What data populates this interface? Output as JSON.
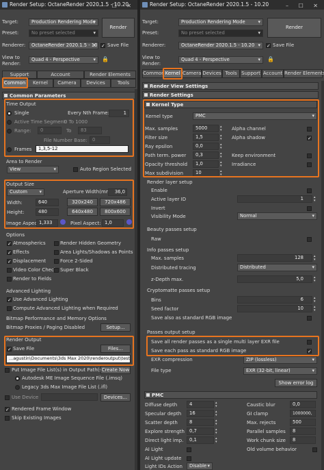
{
  "left_window": {
    "title": "Render Setup: OctaneRender 2020.1.5 - 10.20",
    "target_label": "Target:",
    "target_value": "Production Rendering Mode",
    "preset_label": "Preset:",
    "preset_value": "No preset selected",
    "renderer_label": "Renderer:",
    "renderer_value": "OctaneRender 2020.1.5 - 10.",
    "save_file_label": "Save File",
    "view_label": "View to Render:",
    "view_value": "Quad 4 - Perspective",
    "render_label": "Render",
    "tabs_row1": [
      "Support",
      "Account",
      "Render Elements"
    ],
    "tabs_row2": [
      "Common",
      "Kernel",
      "Camera",
      "Devices",
      "Tools"
    ],
    "rollout": "Common Parameters",
    "time_output": {
      "heading": "Time Output",
      "single": "Single",
      "every_nth": "Every Nth Frame:",
      "every_nth_value": "1",
      "active_segment": "Active Time Segment:",
      "active_segment_value": "0 To 1000",
      "range": "Range:",
      "range_from": "0",
      "to": "To",
      "range_to": "83",
      "file_number_base": "File Number Base:",
      "file_number_base_value": "0",
      "frames": "Frames",
      "frames_value": "1,3,5-12"
    },
    "area": {
      "heading": "Area to Render",
      "value": "View",
      "auto_region": "Auto Region Selected"
    },
    "output_size": {
      "heading": "Output Size",
      "preset": "Custom",
      "aperture_label": "Aperture Width(mm):",
      "aperture_value": "36,0",
      "width_label": "Width:",
      "width_value": "640",
      "height_label": "Height:",
      "height_value": "480",
      "presets": [
        "320x240",
        "720x486",
        "640x480",
        "800x600"
      ],
      "image_aspect_label": "Image Aspect:",
      "image_aspect_value": "1,333",
      "pixel_aspect_label": "Pixel Aspect:",
      "pixel_aspect_value": "1,0"
    },
    "options": {
      "heading": "Options",
      "items": [
        {
          "label": "Atmospherics",
          "checked": true
        },
        {
          "label": "Render Hidden Geometry",
          "checked": false
        },
        {
          "label": "Effects",
          "checked": true
        },
        {
          "label": "Area Lights/Shadows as Points",
          "checked": false
        },
        {
          "label": "Displacement",
          "checked": true
        },
        {
          "label": "Force 2-Sided",
          "checked": false
        },
        {
          "label": "Video Color Check",
          "checked": false
        },
        {
          "label": "Super Black",
          "checked": false
        },
        {
          "label": "Render to Fields",
          "checked": false
        }
      ]
    },
    "adv_lighting": {
      "heading": "Advanced Lighting",
      "use": "Use Advanced Lighting",
      "compute": "Compute Advanced Lighting when Required"
    },
    "bitmap": {
      "heading": "Bitmap Performance and Memory Options",
      "proxies": "Bitmap Proxies / Paging Disabled",
      "setup": "Setup..."
    },
    "render_output": {
      "heading": "Render Output",
      "save_file": "Save File",
      "files": "Files...",
      "path": "...agustin\\Documents\\3ds Max 2020\\renderoutput\\test.png",
      "put_image": "Put Image File List(s) in Output Path(s)",
      "create_now": "Create Now",
      "autodesk": "Autodesk ME Image Sequence File (.imsq)",
      "legacy": "Legacy 3ds Max Image File List (.ifl)",
      "use_device": "Use Device",
      "devices": "Devices...",
      "rendered_frame": "Rendered Frame Window",
      "skip": "Skip Existing Images"
    }
  },
  "right_window": {
    "title": "Render Setup: OctaneRender 2020.1.5 - 10.20",
    "target_label": "Target:",
    "target_value": "Production Rendering Mode",
    "preset_label": "Preset:",
    "preset_value": "No preset selected",
    "renderer_label": "Renderer:",
    "renderer_value": "OctaneRender 2020.1.5 - 10.20",
    "save_file_label": "Save File",
    "view_label": "View to Render:",
    "view_value": "Quad 4 - Perspective",
    "render_label": "Render",
    "tabs": [
      "Common",
      "Kernel",
      "Camera",
      "Devices",
      "Tools",
      "Support",
      "Account",
      "Render Elements"
    ],
    "rollouts": [
      "Render View Settings",
      "Render Settings"
    ],
    "kernel": {
      "rollout": "Kernel Type",
      "type_label": "Kernel type",
      "type_value": "PMC",
      "left": [
        {
          "label": "Max. samples",
          "value": "5000"
        },
        {
          "label": "Filter size",
          "value": "1,5"
        },
        {
          "label": "Ray epsilon",
          "value": "0,0"
        },
        {
          "label": "Path term. power",
          "value": "0,3"
        },
        {
          "label": "Opacity threshold",
          "value": "1,0"
        },
        {
          "label": "Max subdivision",
          "value": "10"
        }
      ],
      "right": [
        {
          "label": "Alpha channel",
          "checked": false
        },
        {
          "label": "Alpha shadow",
          "checked": true
        },
        {
          "label": "Keep environment",
          "checked": false
        },
        {
          "label": "Irradiance",
          "checked": false
        }
      ]
    },
    "render_layer": {
      "heading": "Render layer setup",
      "enable": "Enable",
      "active_layer": "Active layer ID",
      "active_layer_value": "1",
      "invert": "Invert",
      "visibility": "Visibility Mode",
      "visibility_value": "Normal"
    },
    "beauty": {
      "heading": "Beauty passes setup",
      "raw": "Raw"
    },
    "info": {
      "heading": "Info passes setup",
      "max_samples": "Max. samples",
      "max_samples_value": "128",
      "dist_tracing": "Distributed tracing",
      "dist_tracing_value": "Distributed",
      "zdepth": "z-Depth max.",
      "zdepth_value": "5,0"
    },
    "crypto": {
      "heading": "Cryptomatte passes setup",
      "bins": "Bins",
      "bins_value": "6",
      "seed": "Seed factor",
      "seed_value": "10",
      "save": "Save also as standard RGB image"
    },
    "passes_output": {
      "heading": "Passes output setup",
      "save_all": "Save all render passes as a single multi layer EXR file",
      "save_each": "Save each pass as standard RGB image",
      "exr_comp": "EXR compression",
      "exr_comp_value": "ZIP (lossless)",
      "file_type": "File type",
      "file_type_value": "EXR (32-bit, linear)",
      "show_log": "Show error log"
    },
    "pmc": {
      "rollout": "PMC",
      "left": [
        {
          "label": "Diffuse depth",
          "value": "4"
        },
        {
          "label": "Specular depth",
          "value": "16"
        },
        {
          "label": "Scatter depth",
          "value": "8"
        },
        {
          "label": "Explore strength",
          "value": "0,7"
        },
        {
          "label": "Direct light imp.",
          "value": "0,1"
        }
      ],
      "right": [
        {
          "label": "Caustic blur",
          "value": "0,0"
        },
        {
          "label": "GI clamp",
          "value": "1000000,"
        },
        {
          "label": "Max. rejects",
          "value": "500"
        },
        {
          "label": "Parallel samples",
          "value": "8"
        },
        {
          "label": "Work chunk size",
          "value": "8"
        }
      ],
      "ai_light": "AI Light",
      "ai_light_update": "AI Light update",
      "light_ids": "Light IDs Action",
      "light_ids_value": "Disable",
      "old_volume": "Old volume behavior"
    }
  },
  "accent_color": "#e8741f"
}
